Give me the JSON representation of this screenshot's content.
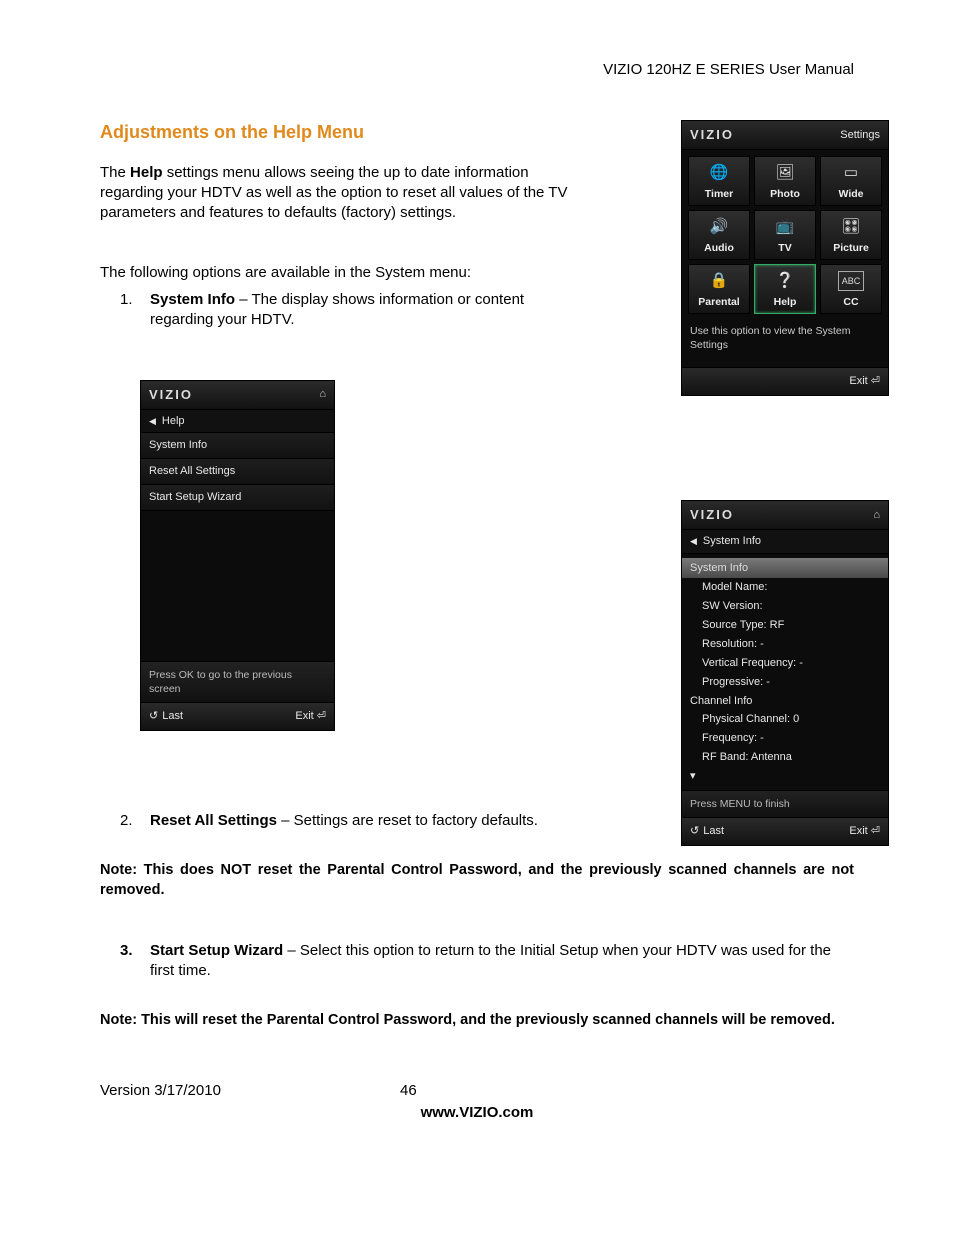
{
  "header": {
    "title": "VIZIO 120HZ E SERIES User Manual"
  },
  "section": {
    "heading": "Adjustments on the Help Menu"
  },
  "intro": {
    "line_pre": "The ",
    "bold1": "Help",
    "line_post": " settings menu allows seeing the up to date information regarding your HDTV as well as the option to reset all values of the TV parameters and features to defaults (factory) settings."
  },
  "sub_intro": "The following options are available in the System menu:",
  "items": {
    "i1_num": "1.",
    "i1_bold": "System Info",
    "i1_rest": " – The display shows information or content regarding your HDTV.",
    "i2_num": "2.",
    "i2_bold": "Reset All Settings",
    "i2_rest": " – Settings are reset to factory defaults.",
    "i3_num": "3.",
    "i3_bold": "Start Setup Wizard",
    "i3_rest": " – Select this option to return to the Initial Setup when your HDTV was used for the first time."
  },
  "notes": {
    "n1": "Note: This does NOT reset the Parental Control Password, and the previously scanned channels are not removed.",
    "n2": "Note: This will reset the Parental Control Password, and the previously scanned channels will be removed."
  },
  "footer": {
    "version": "Version 3/17/2010",
    "page": "46",
    "www": "www.VIZIO.com"
  },
  "help_panel": {
    "brand": "VIZIO",
    "crumb": "Help",
    "m1": "System Info",
    "m2": "Reset All Settings",
    "m3": "Start Setup Wizard",
    "hint": "Press OK to go to the previous screen",
    "last": "Last",
    "exit": "Exit"
  },
  "settings_panel": {
    "brand": "VIZIO",
    "title": "Settings",
    "cells": {
      "c0": "Timer",
      "c1": "Photo",
      "c2": "Wide",
      "c3": "Audio",
      "c4": "TV",
      "c5": "Picture",
      "c6": "Parental",
      "c7": "Help",
      "c8": "CC"
    },
    "desc": "Use this option to view the System Settings",
    "exit": "Exit"
  },
  "sysinfo_panel": {
    "brand": "VIZIO",
    "crumb": "System Info",
    "head": "System Info",
    "l1": "Model Name:",
    "l2": "SW Version:",
    "l3": "Source Type: RF",
    "l4": "Resolution: -",
    "l5": "Vertical Frequency: -",
    "l6": "Progressive: -",
    "g2": "Channel Info",
    "l7": "Physical Channel: 0",
    "l8": "Frequency: -",
    "l9": "RF Band: Antenna",
    "hint": "Press MENU to finish",
    "last": "Last",
    "exit": "Exit"
  }
}
